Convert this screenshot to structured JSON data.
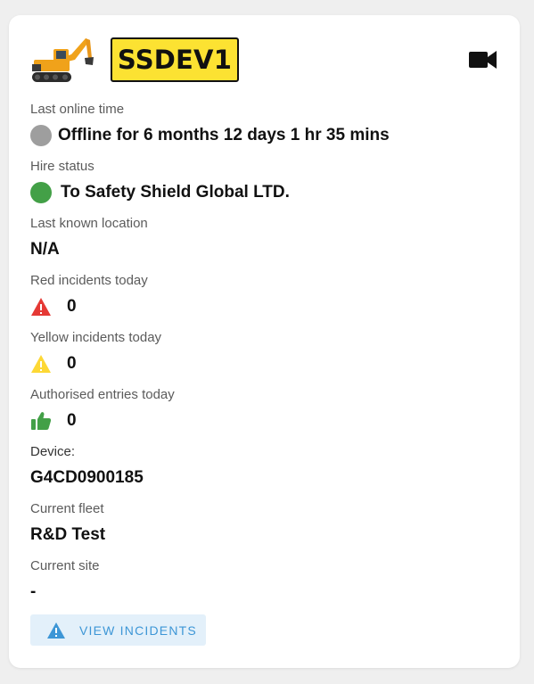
{
  "plate": "SSDEV1",
  "icons": {
    "machine": "excavator-icon",
    "camera": "video-camera-icon",
    "red_incident": "warning-triangle-icon",
    "yellow_incident": "warning-triangle-icon",
    "authorised": "thumbs-up-icon",
    "view_incidents": "warning-triangle-icon"
  },
  "colors": {
    "plate_bg": "#fce232",
    "offline": "#9e9e9e",
    "hire_ok": "#43a047",
    "red_incident": "#e53935",
    "yellow_incident": "#fdd835",
    "authorised": "#43a047",
    "button_bg": "#e3f0fa",
    "button_text": "#3d96d6"
  },
  "fields": {
    "last_online": {
      "label": "Last online time",
      "value": "Offline for 6 months 12 days 1 hr 35 mins"
    },
    "hire_status": {
      "label": "Hire status",
      "value": "To Safety Shield Global LTD."
    },
    "location": {
      "label": "Last known location",
      "value": "N/A"
    },
    "red_incidents": {
      "label": "Red incidents today",
      "value": "0"
    },
    "yellow_incidents": {
      "label": "Yellow incidents today",
      "value": "0"
    },
    "authorised_entries": {
      "label": "Authorised entries today",
      "value": "0"
    },
    "device": {
      "label": "Device:",
      "value": "G4CD0900185"
    },
    "fleet": {
      "label": "Current fleet",
      "value": "R&D Test"
    },
    "site": {
      "label": "Current site",
      "value": "-"
    }
  },
  "button": {
    "label": "VIEW INCIDENTS"
  }
}
